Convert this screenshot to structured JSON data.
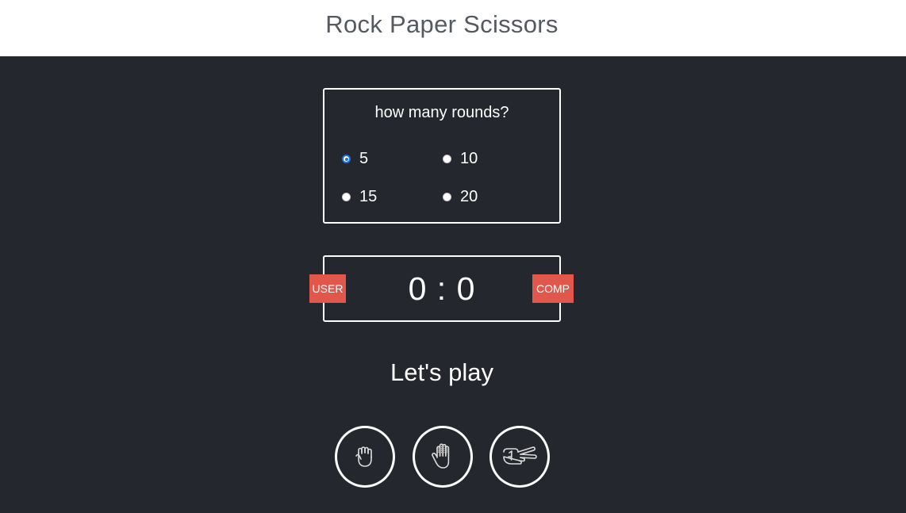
{
  "header": {
    "title": "Rock Paper Scissors"
  },
  "rounds": {
    "question": "how many rounds?",
    "options": [
      {
        "label": "5",
        "selected": true
      },
      {
        "label": "10",
        "selected": false
      },
      {
        "label": "15",
        "selected": false
      },
      {
        "label": "20",
        "selected": false
      }
    ]
  },
  "scoreboard": {
    "user_label": "USER",
    "comp_label": "COMP",
    "score": "0 : 0"
  },
  "message": "Let's play",
  "choices": [
    {
      "icon": "rock-hand-icon"
    },
    {
      "icon": "paper-hand-icon"
    },
    {
      "icon": "scissors-hand-icon"
    }
  ],
  "colors": {
    "background": "#24272e",
    "header_bg": "#ffffff",
    "badge": "#e2574c",
    "radio_selected": "#1a73e8"
  }
}
